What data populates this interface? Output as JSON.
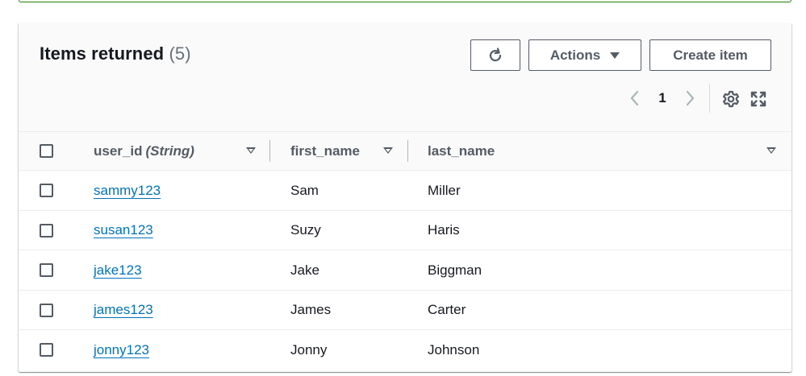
{
  "panel": {
    "title": "Items returned",
    "count": "(5)"
  },
  "toolbar": {
    "refresh_icon": "refresh-icon",
    "actions_label": "Actions",
    "create_label": "Create item"
  },
  "pagination": {
    "current_page": "1",
    "prev_icon": "chevron-left-icon",
    "next_icon": "chevron-right-icon"
  },
  "columns": [
    {
      "name": "user_id",
      "type": "(String)"
    },
    {
      "name": "first_name"
    },
    {
      "name": "last_name"
    }
  ],
  "rows": [
    {
      "user_id": "sammy123",
      "first_name": "Sam",
      "last_name": "Miller"
    },
    {
      "user_id": "susan123",
      "first_name": "Suzy",
      "last_name": "Haris"
    },
    {
      "user_id": "jake123",
      "first_name": "Jake",
      "last_name": "Biggman"
    },
    {
      "user_id": "james123",
      "first_name": "James",
      "last_name": "Carter"
    },
    {
      "user_id": "jonny123",
      "first_name": "Jonny",
      "last_name": "Johnson"
    }
  ],
  "colors": {
    "link": "#0073bb",
    "border": "#545b64",
    "success_border": "#1d8102"
  }
}
